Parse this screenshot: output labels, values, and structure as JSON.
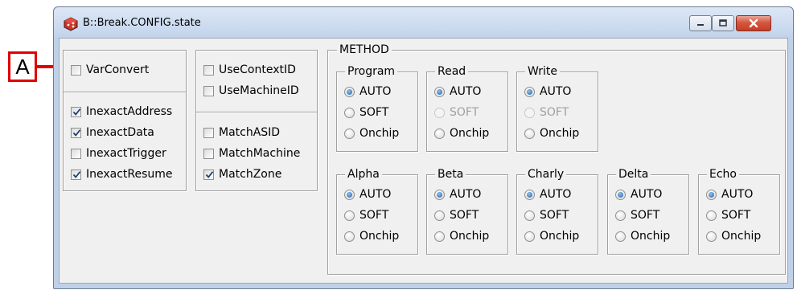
{
  "callout": {
    "label": "A"
  },
  "window": {
    "title": "B::Break.CONFIG.state",
    "buttons": {
      "minimize": "minimize",
      "maximize": "maximize",
      "close": "close"
    }
  },
  "options_group1": {
    "top": [
      {
        "label": "VarConvert",
        "checked": false
      }
    ],
    "bottom": [
      {
        "label": "InexactAddress",
        "checked": true
      },
      {
        "label": "InexactData",
        "checked": true
      },
      {
        "label": "InexactTrigger",
        "checked": false
      },
      {
        "label": "InexactResume",
        "checked": true
      }
    ]
  },
  "options_group2": {
    "top": [
      {
        "label": "UseContextID",
        "checked": false
      },
      {
        "label": "UseMachineID",
        "checked": false
      }
    ],
    "bottom": [
      {
        "label": "MatchASID",
        "checked": false
      },
      {
        "label": "MatchMachine",
        "checked": false
      },
      {
        "label": "MatchZone",
        "checked": true
      }
    ]
  },
  "method": {
    "label": "METHOD",
    "row1": [
      {
        "name": "Program",
        "options": [
          {
            "label": "AUTO",
            "selected": true,
            "disabled": false
          },
          {
            "label": "SOFT",
            "selected": false,
            "disabled": false
          },
          {
            "label": "Onchip",
            "selected": false,
            "disabled": false
          }
        ]
      },
      {
        "name": "Read",
        "options": [
          {
            "label": "AUTO",
            "selected": true,
            "disabled": false
          },
          {
            "label": "SOFT",
            "selected": false,
            "disabled": true
          },
          {
            "label": "Onchip",
            "selected": false,
            "disabled": false
          }
        ]
      },
      {
        "name": "Write",
        "options": [
          {
            "label": "AUTO",
            "selected": true,
            "disabled": false
          },
          {
            "label": "SOFT",
            "selected": false,
            "disabled": true
          },
          {
            "label": "Onchip",
            "selected": false,
            "disabled": false
          }
        ]
      }
    ],
    "row2": [
      {
        "name": "Alpha",
        "options": [
          {
            "label": "AUTO",
            "selected": true,
            "disabled": false
          },
          {
            "label": "SOFT",
            "selected": false,
            "disabled": false
          },
          {
            "label": "Onchip",
            "selected": false,
            "disabled": false
          }
        ]
      },
      {
        "name": "Beta",
        "options": [
          {
            "label": "AUTO",
            "selected": true,
            "disabled": false
          },
          {
            "label": "SOFT",
            "selected": false,
            "disabled": false
          },
          {
            "label": "Onchip",
            "selected": false,
            "disabled": false
          }
        ]
      },
      {
        "name": "Charly",
        "options": [
          {
            "label": "AUTO",
            "selected": true,
            "disabled": false
          },
          {
            "label": "SOFT",
            "selected": false,
            "disabled": false
          },
          {
            "label": "Onchip",
            "selected": false,
            "disabled": false
          }
        ]
      },
      {
        "name": "Delta",
        "options": [
          {
            "label": "AUTO",
            "selected": true,
            "disabled": false
          },
          {
            "label": "SOFT",
            "selected": false,
            "disabled": false
          },
          {
            "label": "Onchip",
            "selected": false,
            "disabled": false
          }
        ]
      },
      {
        "name": "Echo",
        "options": [
          {
            "label": "AUTO",
            "selected": true,
            "disabled": false
          },
          {
            "label": "SOFT",
            "selected": false,
            "disabled": false
          },
          {
            "label": "Onchip",
            "selected": false,
            "disabled": false
          }
        ]
      }
    ]
  }
}
